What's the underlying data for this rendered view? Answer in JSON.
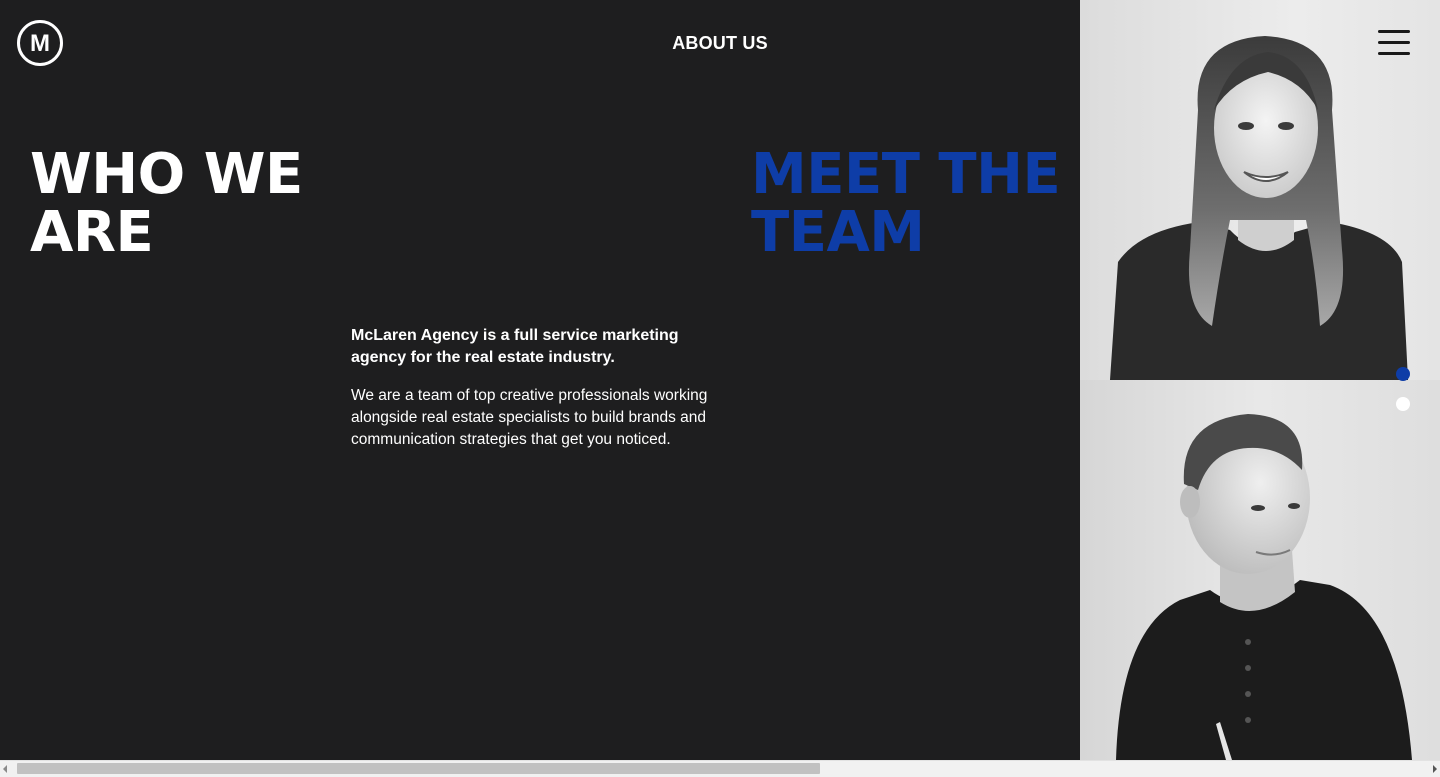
{
  "header": {
    "logo_letter": "M",
    "nav_title": "ABOUT US"
  },
  "who_we_are": {
    "heading_line1": "WHO WE",
    "heading_line2": "ARE"
  },
  "meet_the_team": {
    "heading_line1": "MEET THE",
    "heading_line2": "TEAM"
  },
  "intro": {
    "lead": "McLaren Agency is a full service marketing agency for the real estate industry.",
    "body": "We are a team of top creative professionals working alongside real estate specialists to build brands and communication strategies that get you noticed."
  },
  "team_photos": [
    {
      "icon": "team-member-photo"
    },
    {
      "icon": "team-member-photo"
    }
  ],
  "slider": {
    "active_index": 0,
    "count": 2
  },
  "colors": {
    "background": "#1e1e1f",
    "accent": "#0e3da7",
    "text": "#ffffff"
  }
}
